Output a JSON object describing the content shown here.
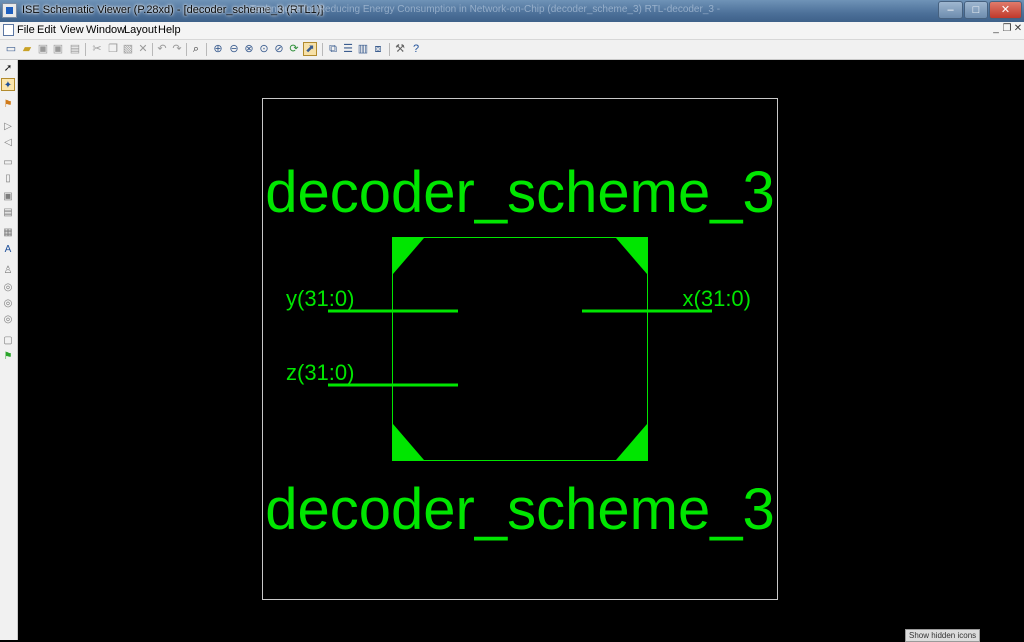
{
  "window": {
    "title": "ISE Schematic Viewer (P.28xd) - [decoder_scheme_3 (RTL1)]",
    "background_title": "Techniques for Reducing Energy Consumption in Network-on-Chip (decoder_scheme_3) RTL-decoder_3 - Design Summary",
    "controls": {
      "minimize": "–",
      "maximize": "□",
      "close": "✕"
    }
  },
  "menubar": {
    "items": [
      "File",
      "Edit",
      "View",
      "Window",
      "Layout",
      "Help"
    ],
    "mdi_controls": {
      "minimize": "_",
      "restore": "❐",
      "close": "✕"
    }
  },
  "toolbar": {
    "icons": [
      "new-file-icon",
      "open-folder-icon",
      "save-icon",
      "save-all-icon",
      "print-icon",
      "cut-icon",
      "copy-icon",
      "paste-icon",
      "delete-icon",
      "undo-icon",
      "redo-icon",
      "find-icon",
      "zoom-in-icon",
      "zoom-out-icon",
      "zoom-full-icon",
      "zoom-area-icon",
      "zoom-select-icon",
      "refresh-icon",
      "pan-icon",
      "cascade-icon",
      "tile-horizontal-icon",
      "tile-vertical-icon",
      "arrange-icon",
      "properties-icon",
      "help-icon"
    ]
  },
  "lefttools": {
    "icons": [
      "select-arrow-icon",
      "select-net-icon",
      "add-wire-icon",
      "expand-icon",
      "collapse-icon",
      "up-level-icon",
      "push-into-icon",
      "show-pins-icon",
      "hide-pins-icon",
      "instance-icon",
      "text-icon",
      "add-instance-icon",
      "previous-icon",
      "next-icon",
      "back-icon",
      "fit-icon",
      "green-flag-icon"
    ]
  },
  "schematic": {
    "top_label": "decoder_scheme_3",
    "bottom_label": "decoder_scheme_3",
    "ports": {
      "input_y": "y(31:0)",
      "input_z": "z(31:0)",
      "output_x": "x(31:0)"
    },
    "colors": {
      "wire": "#00e600",
      "text": "#00e600",
      "border": "#c8c8c8",
      "background": "#000000"
    }
  },
  "tooltip": {
    "text": "Show hidden icons"
  }
}
